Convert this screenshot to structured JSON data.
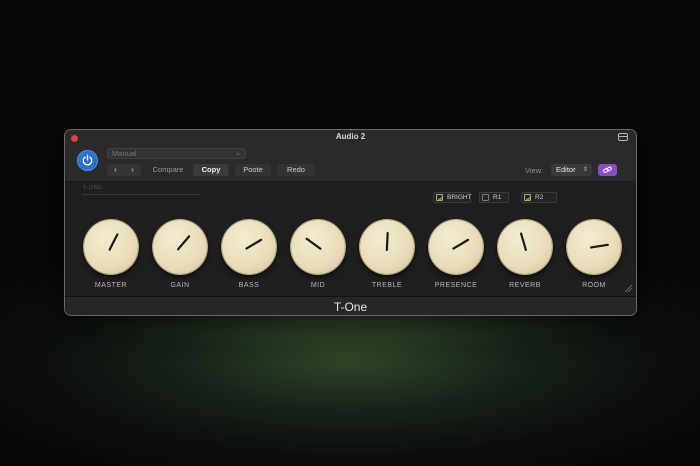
{
  "window": {
    "title": "Audio 2"
  },
  "toolbar": {
    "preset": "Manual",
    "nav_back": "‹",
    "nav_forward": "›",
    "compare_label": "Compare",
    "copy_label": "Copy",
    "paste_label": "Poote",
    "redo_label": "Redo",
    "view_label": "View:",
    "view_value": "Editor"
  },
  "panel": {
    "model_label": "T-ONE",
    "switches": [
      {
        "label": "BRIGHT",
        "checked": true
      },
      {
        "label": "R1",
        "checked": false
      },
      {
        "label": "R2",
        "checked": true
      }
    ],
    "knobs": [
      {
        "label": "MASTER",
        "level": 0.6
      },
      {
        "label": "GAIN",
        "level": 0.65
      },
      {
        "label": "BASS",
        "level": 0.72
      },
      {
        "label": "MID",
        "level": 0.3
      },
      {
        "label": "TREBLE",
        "level": 0.51
      },
      {
        "label": "PRESENCE",
        "level": 0.72
      },
      {
        "label": "REVERB",
        "level": 0.44
      },
      {
        "label": "ROOM",
        "level": 0.8
      }
    ]
  },
  "footer": {
    "plugin_name": "T-One"
  },
  "colors": {
    "power_blue": "#2a72c6",
    "link_purple": "#8a4bc7",
    "knob_cream": "#ece2c2",
    "check_green": "#8cc070"
  },
  "icons": {
    "power": "power-icon",
    "link": "link-icon",
    "sidebar": "sidebar-toggle-icon",
    "close": "close-icon"
  }
}
